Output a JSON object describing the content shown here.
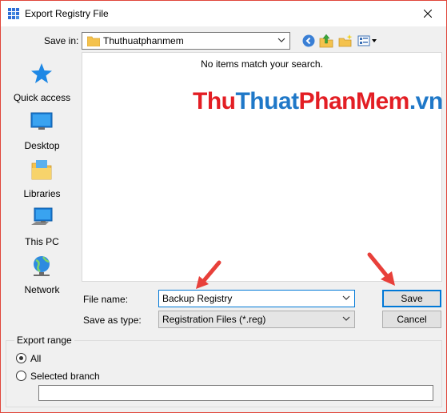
{
  "window": {
    "title": "Export Registry File",
    "accent_color": "#0078d7"
  },
  "toolbar": {
    "save_in_label": "Save in:",
    "save_in_value": "Thuthuatphanmem",
    "icons": [
      "back-icon",
      "up-folder-icon",
      "new-folder-icon",
      "view-menu-icon"
    ]
  },
  "places": [
    {
      "label": "Quick access",
      "icon": "star-icon"
    },
    {
      "label": "Desktop",
      "icon": "desktop-icon"
    },
    {
      "label": "Libraries",
      "icon": "libraries-icon"
    },
    {
      "label": "This PC",
      "icon": "computer-icon"
    },
    {
      "label": "Network",
      "icon": "network-icon"
    }
  ],
  "filelist": {
    "empty_message": "No items match your search."
  },
  "watermark": {
    "part1": "Thu",
    "part2": "Thuat",
    "part3": "PhanMem",
    "part4": ".vn"
  },
  "form": {
    "file_name_label": "File name:",
    "file_name_value": "Backup Registry",
    "save_type_label": "Save as type:",
    "save_type_value": "Registration Files (*.reg)",
    "save_button": "Save",
    "cancel_button": "Cancel"
  },
  "export_range": {
    "title": "Export range",
    "all_label": "All",
    "branch_label": "Selected branch",
    "selected": "All",
    "branch_value": ""
  }
}
